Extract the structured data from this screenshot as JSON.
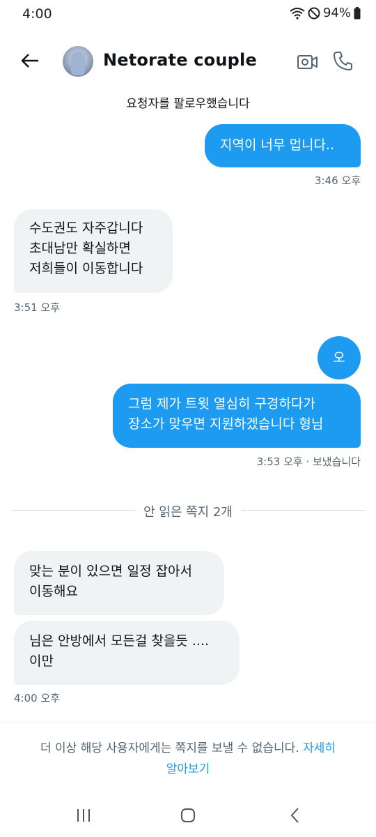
{
  "status_bar": {
    "time": "4:00",
    "battery": "94%"
  },
  "header": {
    "title": "Netorate couple"
  },
  "system_message": "요청자를 팔로우했습니다",
  "messages": [
    {
      "lines": [
        "지역이 너무 멉니다.."
      ],
      "time": "3:46 오후"
    },
    {
      "lines": [
        "수도권도 자주갑니다",
        "초대남만 확실하면",
        "저희들이 이동합니다"
      ],
      "time": "3:51 오후"
    },
    {
      "lines": [
        "오"
      ]
    },
    {
      "lines": [
        "그럼 제가 트윗 열심히 구경하다가",
        "장소가 맞우면 지원하겠습니다 형님"
      ],
      "time": "3:53 오후 · 보냈습니다"
    },
    {
      "lines": [
        "맞는 분이 있으면 일정 잡아서",
        "이동해요"
      ]
    },
    {
      "lines": [
        "님은 안방에서 모든걸 찾을듯 ....",
        "이만"
      ],
      "time": "4:00 오후"
    }
  ],
  "divider": {
    "label": "안 읽은 쪽지 2개"
  },
  "footer": {
    "note": "더 이상 해당 사용자에게는 쪽지를 보낼 수 없습니다.",
    "link_line1": "자세히",
    "link_line2": "알아보기"
  },
  "colors": {
    "accent": "#1d9bf0",
    "incoming_bubble": "#eff3f4",
    "meta_text": "#536471"
  },
  "icons": [
    "wifi-icon",
    "do-not-disturb-icon",
    "battery-icon",
    "back-arrow-icon",
    "video-call-icon",
    "phone-icon",
    "recent-apps-icon",
    "home-icon",
    "nav-back-icon"
  ]
}
